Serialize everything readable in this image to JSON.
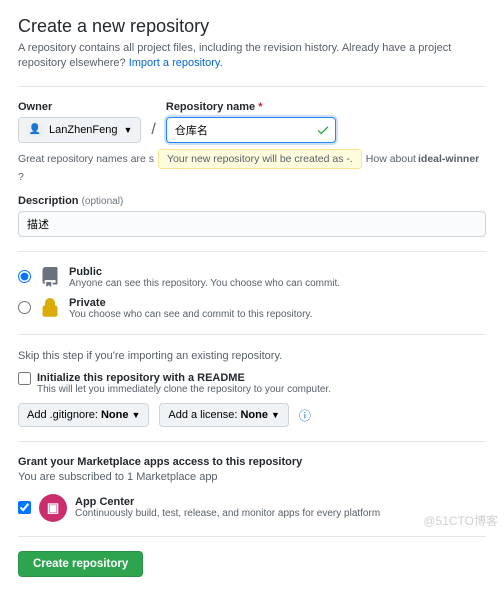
{
  "header": {
    "title": "Create a new repository",
    "subtitle": "A repository contains all project files, including the revision history. Already have a project repository elsewhere?",
    "import_link": "Import a repository."
  },
  "owner": {
    "label": "Owner",
    "selected": "LanZhenFeng"
  },
  "repo": {
    "label": "Repository name",
    "value": "仓库名",
    "hint_prefix": "Great repository names are s",
    "tooltip": "Your new repository will be created as -.",
    "hint_suffix_1": "How about ",
    "suggestion": "ideal-winner",
    "hint_suffix_2": "?"
  },
  "description": {
    "label": "Description",
    "optional": "(optional)",
    "value": "描述"
  },
  "visibility": {
    "public": {
      "label": "Public",
      "desc": "Anyone can see this repository. You choose who can commit."
    },
    "private": {
      "label": "Private",
      "desc": "You choose who can see and commit to this repository."
    }
  },
  "init": {
    "skip_text": "Skip this step if you're importing an existing repository.",
    "readme_label": "Initialize this repository with a README",
    "readme_desc": "This will let you immediately clone the repository to your computer."
  },
  "options": {
    "gitignore_prefix": "Add .gitignore: ",
    "gitignore_value": "None",
    "license_prefix": "Add a license: ",
    "license_value": "None"
  },
  "marketplace": {
    "heading": "Grant your Marketplace apps access to this repository",
    "subtext": "You are subscribed to 1 Marketplace app",
    "app_name": "App Center",
    "app_desc": "Continuously build, test, release, and monitor apps for every platform"
  },
  "submit": {
    "label": "Create repository"
  },
  "watermark": "@51CTO博客"
}
